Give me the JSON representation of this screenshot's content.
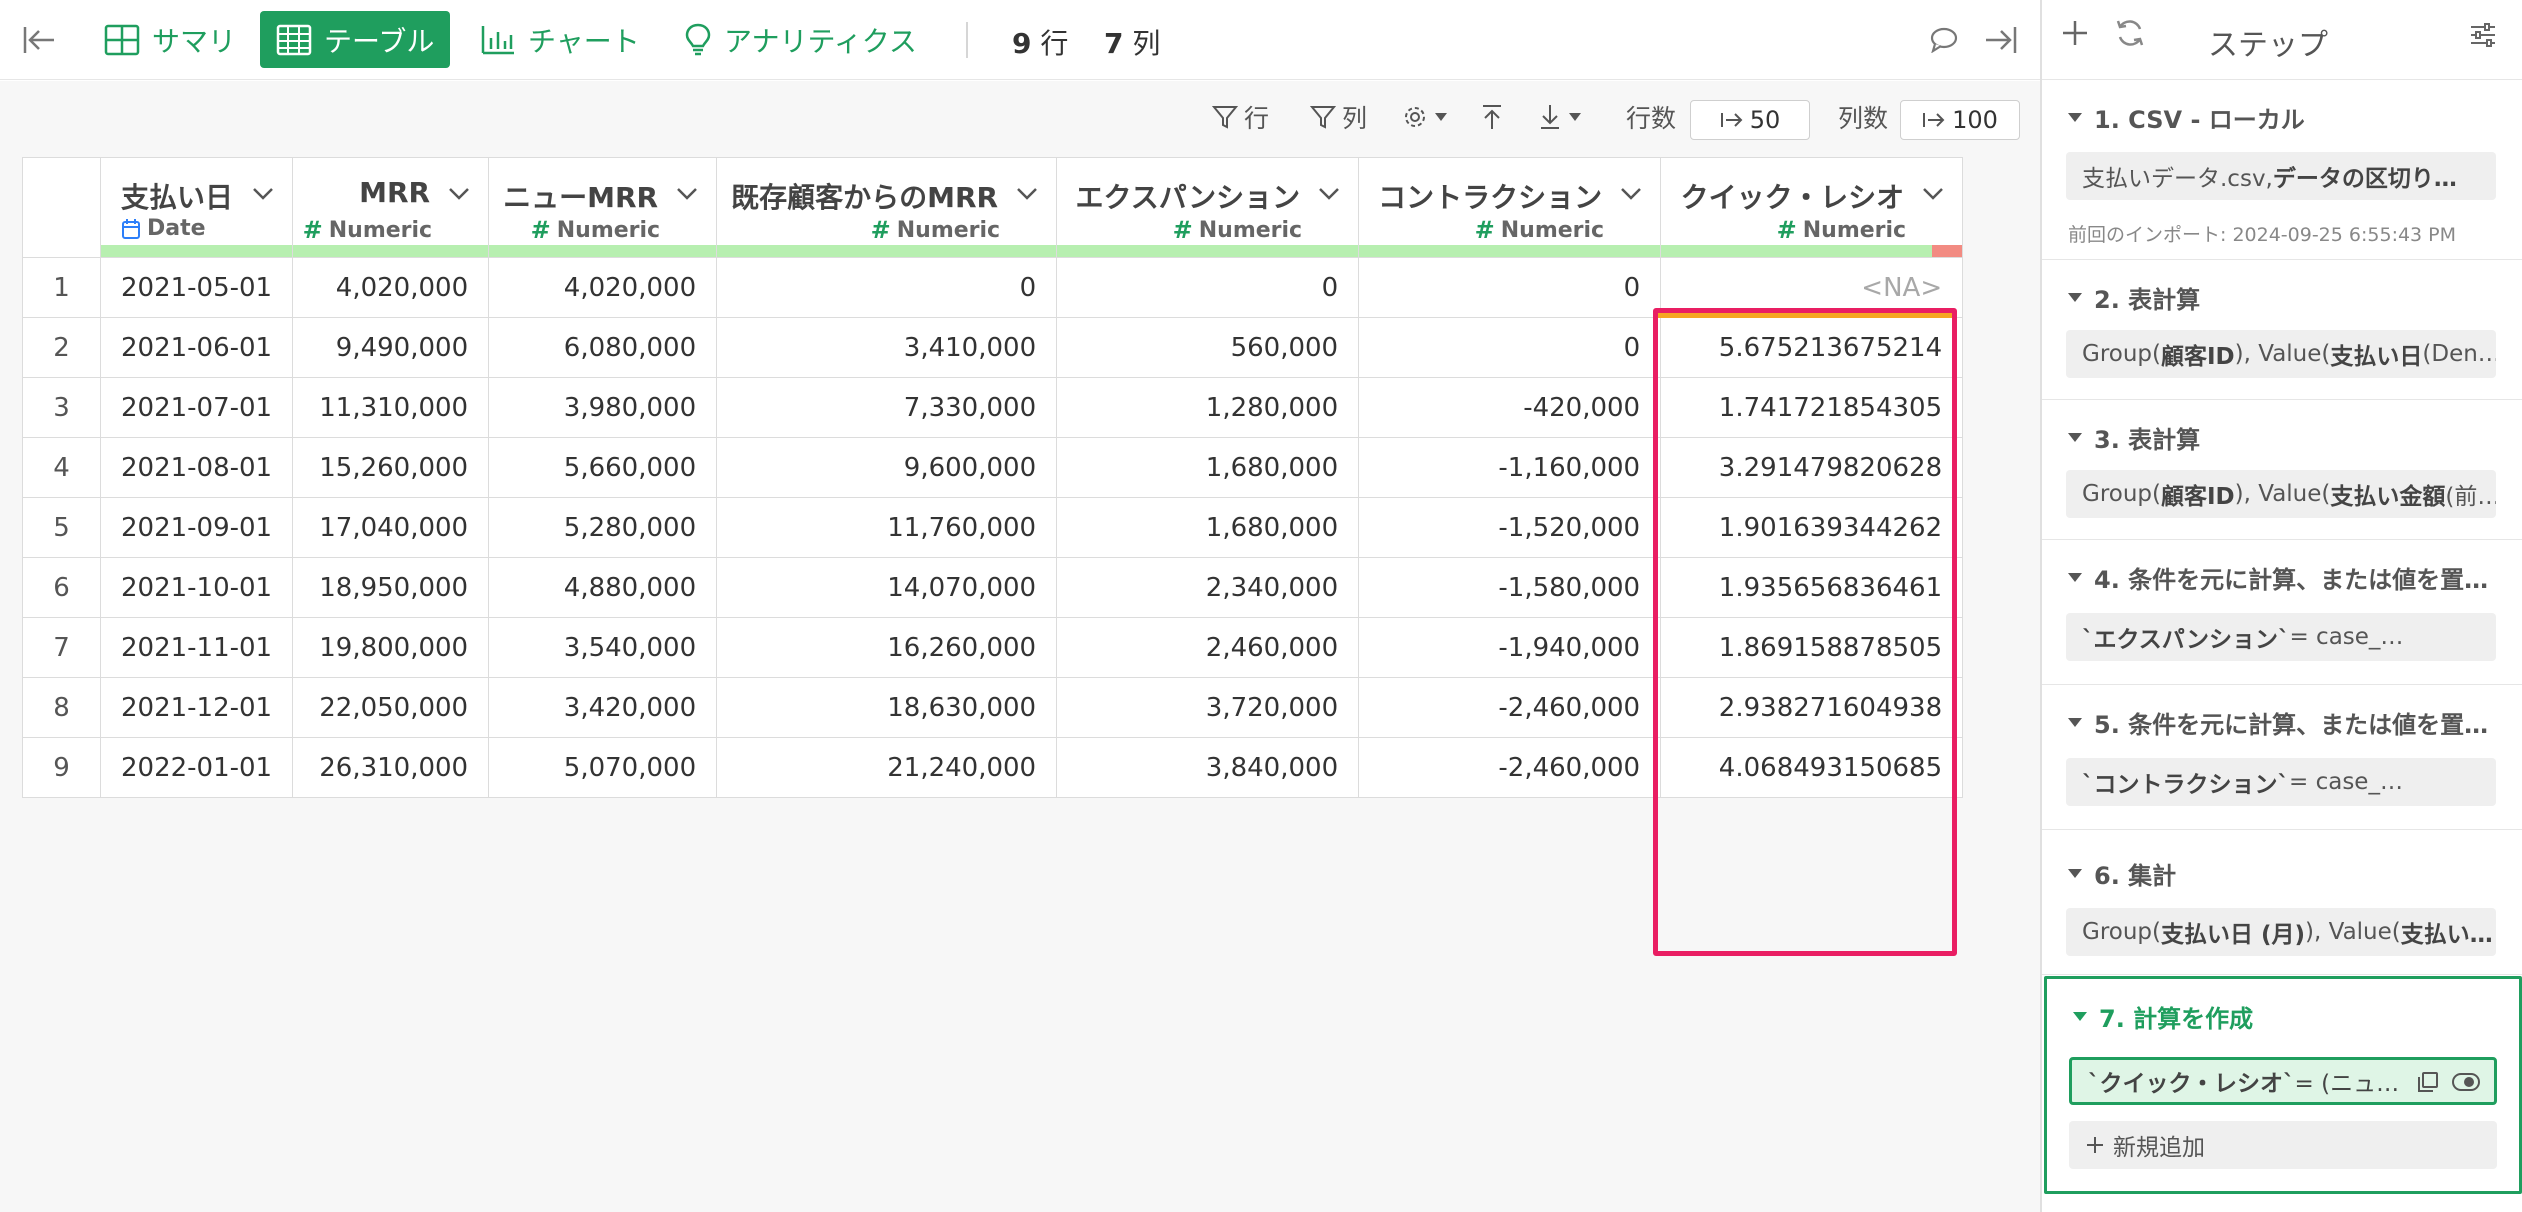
{
  "tabs": {
    "summary": "サマリ",
    "table": "テーブル",
    "chart": "チャート",
    "analytics": "アナリティクス"
  },
  "counts": {
    "rows": "9",
    "rows_unit": "行",
    "cols": "7",
    "cols_unit": "列"
  },
  "toolbar": {
    "row_filter": "行",
    "col_filter": "列",
    "rows_label": "行数",
    "rows_value": "50",
    "cols_label": "列数",
    "cols_value": "100"
  },
  "columns": [
    {
      "name": "支払い日",
      "type": "Date"
    },
    {
      "name": "MRR",
      "type": "Numeric"
    },
    {
      "name": "ニューMRR",
      "type": "Numeric"
    },
    {
      "name": "既存顧客からのMRR",
      "type": "Numeric"
    },
    {
      "name": "エクスパンション",
      "type": "Numeric"
    },
    {
      "name": "コントラクション",
      "type": "Numeric"
    },
    {
      "name": "クイック・レシオ",
      "type": "Numeric"
    }
  ],
  "rows": [
    [
      "1",
      "2021-05-01",
      "4,020,000",
      "4,020,000",
      "0",
      "0",
      "0",
      "<NA>"
    ],
    [
      "2",
      "2021-06-01",
      "9,490,000",
      "6,080,000",
      "3,410,000",
      "560,000",
      "0",
      "5.675213675214"
    ],
    [
      "3",
      "2021-07-01",
      "11,310,000",
      "3,980,000",
      "7,330,000",
      "1,280,000",
      "-420,000",
      "1.741721854305"
    ],
    [
      "4",
      "2021-08-01",
      "15,260,000",
      "5,660,000",
      "9,600,000",
      "1,680,000",
      "-1,160,000",
      "3.291479820628"
    ],
    [
      "5",
      "2021-09-01",
      "17,040,000",
      "5,280,000",
      "11,760,000",
      "1,680,000",
      "-1,520,000",
      "1.901639344262"
    ],
    [
      "6",
      "2021-10-01",
      "18,950,000",
      "4,880,000",
      "14,070,000",
      "2,340,000",
      "-1,580,000",
      "1.935656836461"
    ],
    [
      "7",
      "2021-11-01",
      "19,800,000",
      "3,540,000",
      "16,260,000",
      "2,460,000",
      "-1,940,000",
      "1.869158878505"
    ],
    [
      "8",
      "2021-12-01",
      "22,050,000",
      "3,420,000",
      "18,630,000",
      "3,720,000",
      "-2,460,000",
      "2.938271604938"
    ],
    [
      "9",
      "2022-01-01",
      "26,310,000",
      "5,070,000",
      "21,240,000",
      "3,840,000",
      "-2,460,000",
      "4.068493150685"
    ]
  ],
  "steps_panel": {
    "title": "ステップ",
    "steps": [
      {
        "title": "1. CSV - ローカル",
        "box_plain": "支払いデータ.csv, ",
        "box_bold": "データの区切り…",
        "note": "前回のインポート: 2024-09-25 6:55:43 PM"
      },
      {
        "title": "2. 表計算",
        "p1": "Group(",
        "b1": "顧客ID",
        "p2": "), Value(",
        "b2": "支払い日",
        "p3": " (Den…"
      },
      {
        "title": "3. 表計算",
        "p1": "Group(",
        "b1": "顧客ID",
        "p2": "), Value(",
        "b2": "支払い金額",
        "p3": " (前…"
      },
      {
        "title": "4. 条件を元に計算、または値を置…",
        "code_bold": "`エクスパンション`",
        "code_rest": " = case_…"
      },
      {
        "title": "5. 条件を元に計算、または値を置…",
        "code_bold": "`コントラクション`",
        "code_rest": " = case_…"
      },
      {
        "title": "6. 集計",
        "p1": "Group(",
        "b1": "支払い日 (月)",
        "p2": "), Value(",
        "b2": "支払い…"
      },
      {
        "title": "7. 計算を作成",
        "code_bold": "`クイック・レシオ`",
        "code_rest": " = (ニュ…"
      }
    ],
    "new_add": "新規追加"
  },
  "colors": {
    "accent": "#1f9e5e",
    "highlight": "#e91e63"
  },
  "icons": [
    "collapse-left-icon",
    "summary-grid-icon",
    "table-icon",
    "bar-chart-icon",
    "lightbulb-icon",
    "comment-icon",
    "expand-right-icon",
    "filter-icon",
    "gear-icon",
    "upload-icon",
    "download-icon",
    "plus-icon",
    "refresh-icon",
    "sliders-icon",
    "copy-icon",
    "eye-icon",
    "calendar-icon",
    "hash-icon",
    "chevron-down-icon"
  ]
}
